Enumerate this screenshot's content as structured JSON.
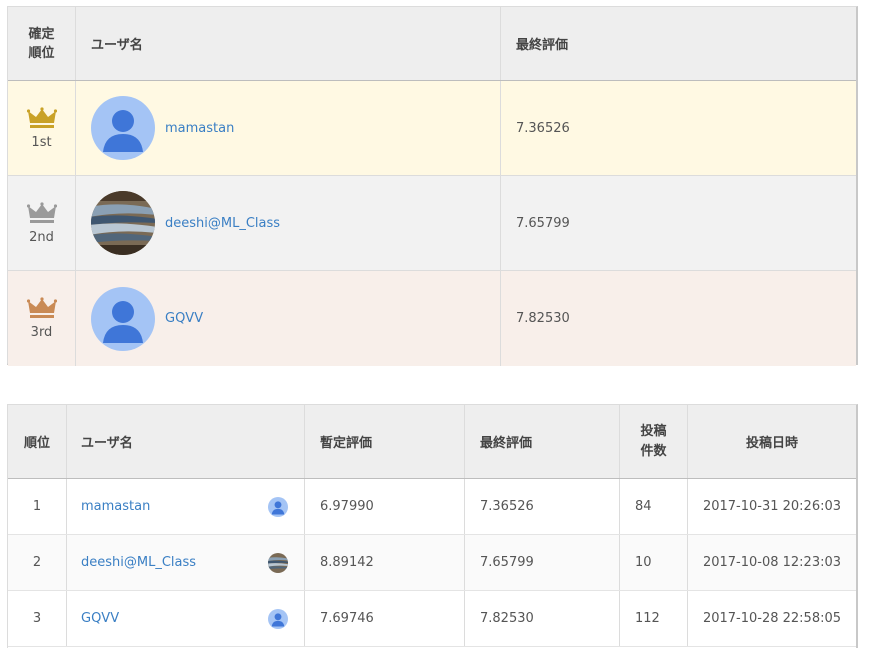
{
  "podium": {
    "headers": {
      "rank": "確定\n順位",
      "user": "ユーザ名",
      "final": "最終評価"
    },
    "rows": [
      {
        "rank": "1st",
        "user": "mamastan",
        "final": "7.36526",
        "avatar": "default-avatar",
        "crown_color": "#c9a227"
      },
      {
        "rank": "2nd",
        "user": "deeshi@ML_Class",
        "final": "7.65799",
        "avatar": "fish-photo-avatar",
        "crown_color": "#9a9a9a"
      },
      {
        "rank": "3rd",
        "user": "GQVV",
        "final": "7.82530",
        "avatar": "default-avatar",
        "crown_color": "#c98a55"
      }
    ]
  },
  "ranking": {
    "headers": {
      "rank": "順位",
      "user": "ユーザ名",
      "provisional": "暫定評価",
      "final": "最終評価",
      "count": "投稿\n件数",
      "date": "投稿日時"
    },
    "rows": [
      {
        "rank": "1",
        "user": "mamastan",
        "provisional": "6.97990",
        "final": "7.36526",
        "count": "84",
        "date": "2017-10-31 20:26:03",
        "avatar": "default-avatar"
      },
      {
        "rank": "2",
        "user": "deeshi@ML_Class",
        "provisional": "8.89142",
        "final": "7.65799",
        "count": "10",
        "date": "2017-10-08 12:23:03",
        "avatar": "fish-photo-avatar"
      },
      {
        "rank": "3",
        "user": "GQVV",
        "provisional": "7.69746",
        "final": "7.82530",
        "count": "112",
        "date": "2017-10-28 22:58:05",
        "avatar": "default-avatar"
      }
    ]
  },
  "colors": {
    "link": "#3a7fc4",
    "gold_row": "#fff9e3",
    "silver_row": "#f2f2f2",
    "bronze_row": "#f8efea",
    "avatar_bg": "#a4c4f5",
    "avatar_fg": "#3f76d8"
  }
}
